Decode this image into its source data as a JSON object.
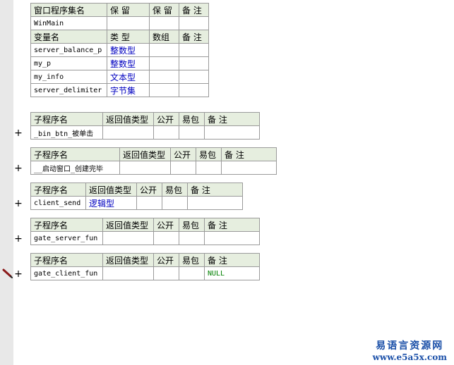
{
  "assembly": {
    "headers": [
      "窗口程序集名",
      "保 留",
      "保 留",
      "备 注"
    ],
    "name": "WinMain"
  },
  "variables": {
    "headers": [
      "变量名",
      "类 型",
      "数组",
      "备 注"
    ],
    "rows": [
      {
        "name": "server_balance_p",
        "type": "整数型"
      },
      {
        "name": "my_p",
        "type": "整数型"
      },
      {
        "name": "my_info",
        "type": "文本型"
      },
      {
        "name": "server_delimiter",
        "type": "字节集"
      }
    ]
  },
  "subroutine_headers": [
    "子程序名",
    "返回值类型",
    "公开",
    "易包",
    "备 注"
  ],
  "subroutines": [
    {
      "name": "_bin_btn_被单击",
      "return_type": "",
      "remark": "",
      "expander": "+"
    },
    {
      "name": "__启动窗口_创建完毕",
      "return_type": "",
      "remark": "",
      "expander": "+"
    },
    {
      "name": "client_send",
      "return_type": "逻辑型",
      "remark": "",
      "expander": "+"
    },
    {
      "name": "gate_server_fun",
      "return_type": "",
      "remark": "",
      "expander": "+"
    },
    {
      "name": "gate_client_fun",
      "return_type": "",
      "remark": "NULL",
      "expander": "+"
    }
  ],
  "icons": {
    "edit_marker": "pencil-icon"
  },
  "colors": {
    "header_bg": "#e6eedf",
    "type_text": "#0000c0",
    "remark_text": "#008000",
    "watermark": "#1a4fa8"
  },
  "watermark": {
    "line1": "易语言资源网",
    "line2": "www.e5a5x.com"
  }
}
